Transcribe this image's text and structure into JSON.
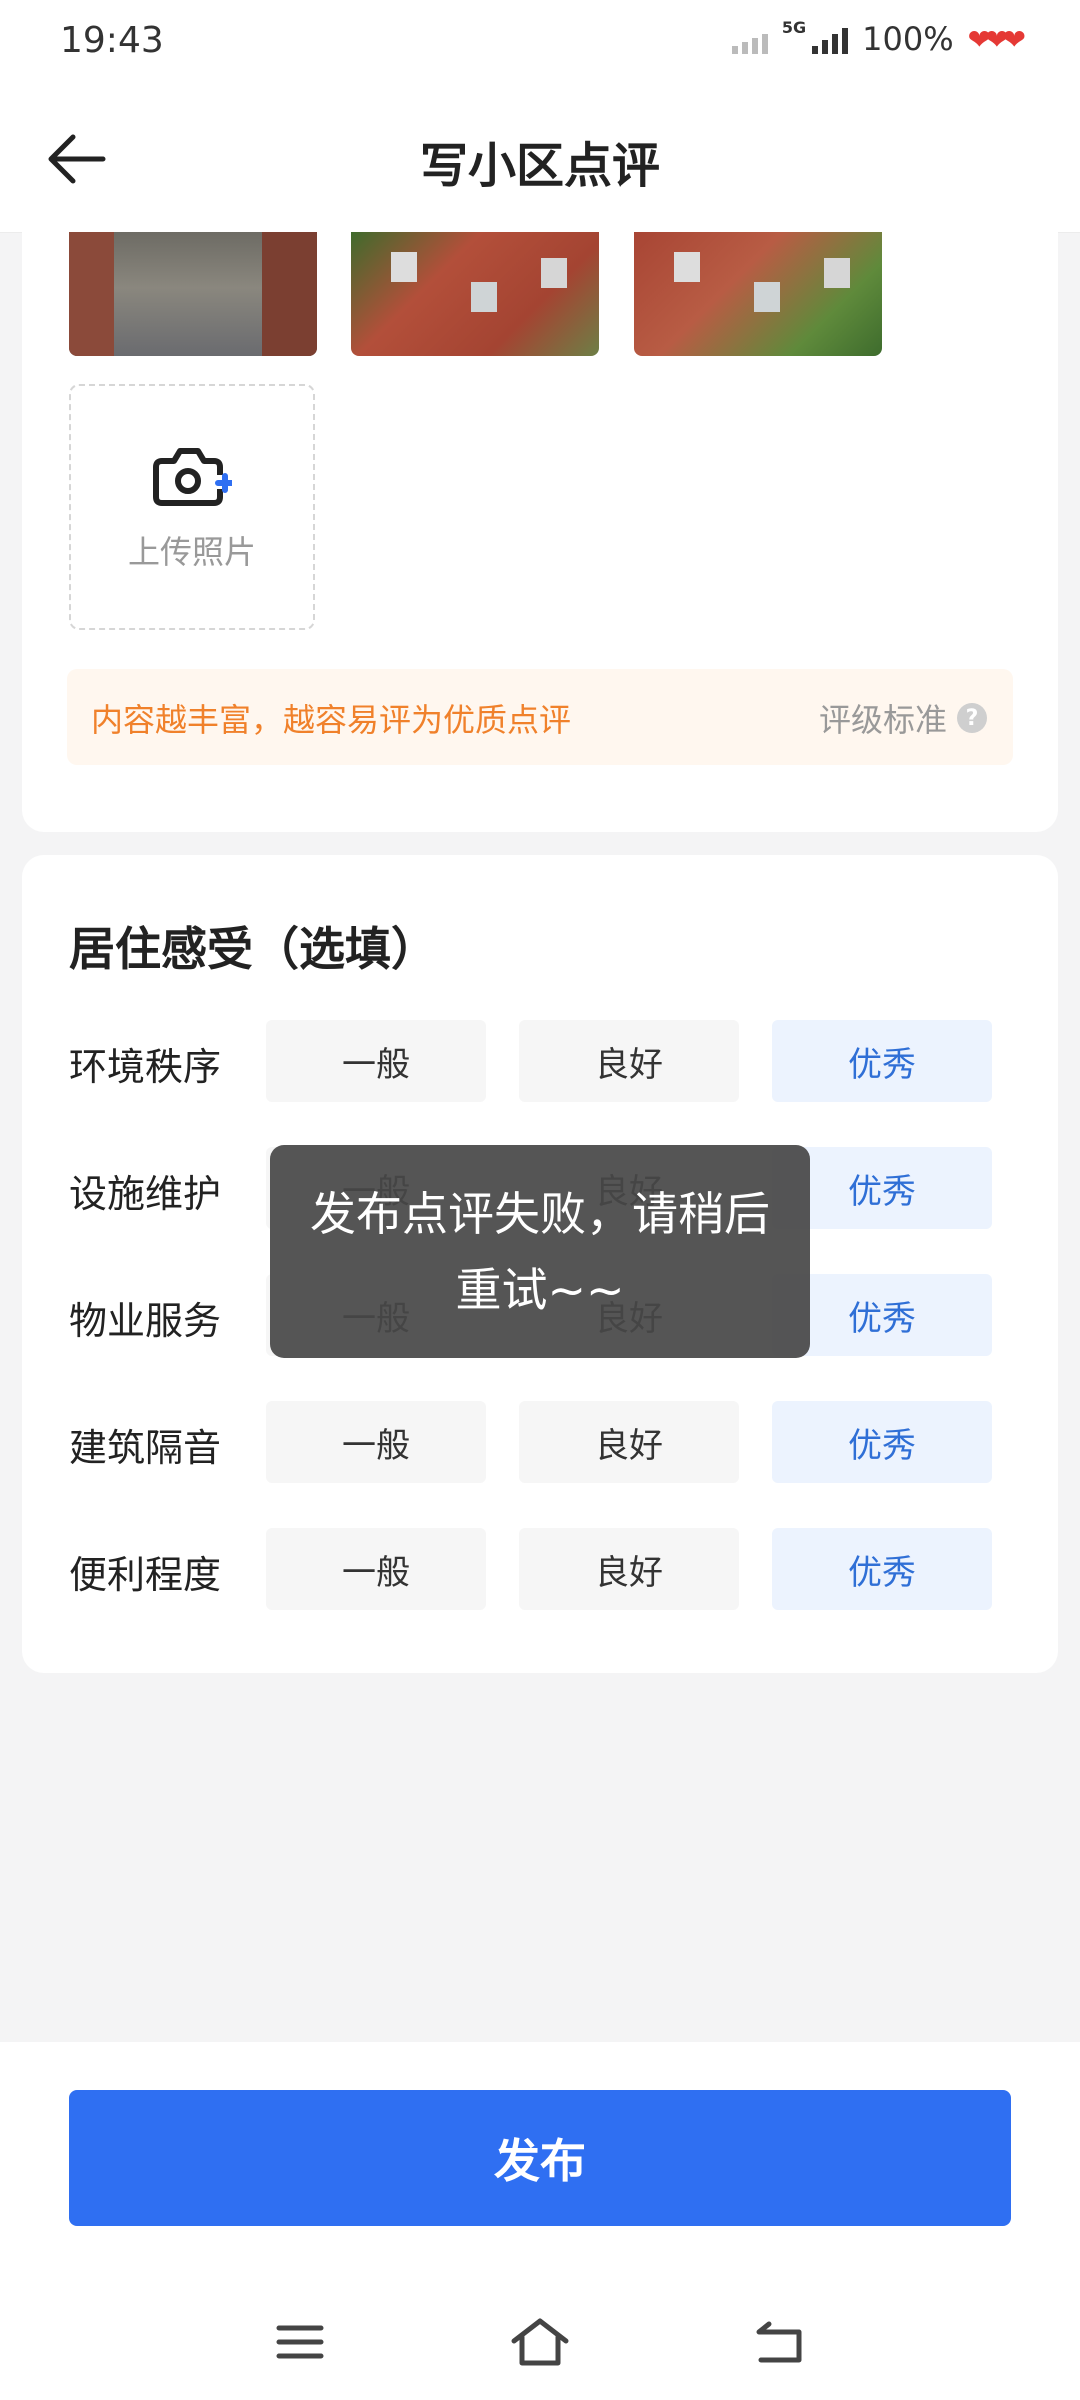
{
  "status_bar": {
    "time": "19:43",
    "network": "5G",
    "battery": "100%"
  },
  "header": {
    "title": "写小区点评"
  },
  "photos": {
    "upload_label": "上传照片",
    "tip_text": "内容越丰富，越容易评为优质点评",
    "rating_standard_link": "评级标准",
    "help_icon_text": "?"
  },
  "living_experience": {
    "title": "居住感受（选填）",
    "rows": [
      {
        "label": "环境秩序",
        "options": [
          "一般",
          "良好",
          "优秀"
        ],
        "selected": "优秀"
      },
      {
        "label": "设施维护",
        "options": [
          "一般",
          "良好",
          "优秀"
        ],
        "selected": "优秀"
      },
      {
        "label": "物业服务",
        "options": [
          "一般",
          "良好",
          "优秀"
        ],
        "selected": "优秀"
      },
      {
        "label": "建筑隔音",
        "options": [
          "一般",
          "良好",
          "优秀"
        ],
        "selected": "优秀"
      },
      {
        "label": "便利程度",
        "options": [
          "一般",
          "良好",
          "优秀"
        ],
        "selected": "优秀"
      }
    ]
  },
  "toast": {
    "message": "发布点评失败，请稍后重试~~"
  },
  "footer": {
    "publish_label": "发布"
  },
  "colors": {
    "accent": "#2f6ff2",
    "selected_bg": "#ecf3fe",
    "selected_text": "#2f6fd6",
    "tip_text": "#f0812b"
  }
}
